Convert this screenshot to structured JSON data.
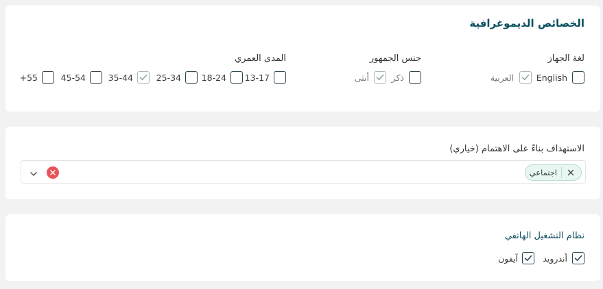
{
  "demographics": {
    "title": "الخصائص الديموغرافية",
    "device_language": {
      "label": "لغة الجهاز",
      "options": [
        {
          "label": "English",
          "checked": false
        },
        {
          "label": "العربية",
          "checked": true
        }
      ]
    },
    "audience_gender": {
      "label": "جنس الجمهور",
      "options": [
        {
          "label": "ذكر",
          "checked": false
        },
        {
          "label": "أنثى",
          "checked": true
        }
      ]
    },
    "age_range": {
      "label": "المدى العمري",
      "options": [
        {
          "label": "13-17",
          "checked": false
        },
        {
          "label": "18-24",
          "checked": false
        },
        {
          "label": "25-34",
          "checked": false
        },
        {
          "label": "35-44",
          "checked": true
        },
        {
          "label": "45-54",
          "checked": false
        },
        {
          "label": "+55",
          "checked": false
        }
      ]
    }
  },
  "interest_targeting": {
    "label": "الاستهداف بناءً على الاهتمام (خياري)",
    "selected_chip": "اجتماعي"
  },
  "mobile_os": {
    "label": "نظام التشغيل الهاتفي",
    "options": [
      {
        "label": "أندرويد",
        "checked": true
      },
      {
        "label": "آيفون",
        "checked": true
      }
    ]
  },
  "colors": {
    "title": "#0c5060",
    "checkbox_border": "#2c4650",
    "chip_bg": "#e9f6f1",
    "chip_border": "#b8ddd0",
    "clear_button": "#e8545a",
    "page_bg": "#f2f2f2"
  }
}
